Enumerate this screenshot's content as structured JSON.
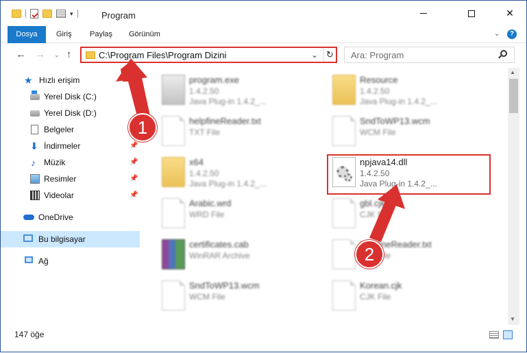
{
  "window": {
    "title": "Program",
    "controls": {
      "minimize": "–",
      "maximize": "☐",
      "close": "✕"
    }
  },
  "ribbon": {
    "tabs": [
      {
        "label": "Dosya",
        "active": true
      },
      {
        "label": "Giriş"
      },
      {
        "label": "Paylaş"
      },
      {
        "label": "Görünüm"
      }
    ],
    "help": "?"
  },
  "navigation": {
    "address": "C:\\Program Files\\Program Dizini",
    "search_placeholder": "Ara: Program"
  },
  "sidebar": {
    "items": [
      {
        "label": "Hızlı erişim",
        "icon": "star-icon"
      },
      {
        "label": "Yerel Disk (C:)",
        "icon": "drive-icon",
        "pinned": true
      },
      {
        "label": "Yerel Disk (D:)",
        "icon": "drive-icon",
        "pinned": true
      },
      {
        "label": "Belgeler",
        "icon": "documents-icon",
        "pinned": true
      },
      {
        "label": "İndirmeler",
        "icon": "downloads-icon",
        "pinned": true
      },
      {
        "label": "Müzik",
        "icon": "music-icon",
        "pinned": true
      },
      {
        "label": "Resimler",
        "icon": "pictures-icon",
        "pinned": true
      },
      {
        "label": "Videolar",
        "icon": "videos-icon",
        "pinned": true
      },
      {
        "label": "OneDrive",
        "icon": "cloud-icon"
      },
      {
        "label": "Bu bilgisayar",
        "icon": "computer-icon",
        "selected": true
      },
      {
        "label": "Ağ",
        "icon": "network-icon"
      }
    ]
  },
  "files": [
    {
      "name": "program.exe",
      "line2": "1.4.2.50",
      "line3": "Java Plug-in 1.4.2_...",
      "icon": "exe-icon"
    },
    {
      "name": "Resource",
      "line2": "1.4.2.50",
      "line3": "Java Plug-in 1.4.2_...",
      "icon": "folder-icon"
    },
    {
      "name": "helpfineReader.txt",
      "line2": "TXT File",
      "line3": "",
      "icon": "document-icon"
    },
    {
      "name": "SndToWP13.wcm",
      "line2": "WCM File",
      "line3": "",
      "icon": "document-icon"
    },
    {
      "name": "x64",
      "line2": "1.4.2.50",
      "line3": "Java Plug-in 1.4.2_...",
      "icon": "folder-icon"
    },
    {
      "name": "npjava14.dll",
      "line2": "1.4.2.50",
      "line3": "Java Plug-in 1.4.2_...",
      "icon": "dll-gear-icon",
      "highlighted": true
    },
    {
      "name": "Arabic.wrd",
      "line2": "WRD File",
      "line3": "",
      "icon": "document-icon"
    },
    {
      "name": "gbl.cjk",
      "line2": "CJK File",
      "line3": "",
      "icon": "document-icon"
    },
    {
      "name": "certificates.cab",
      "line2": "WinRAR Archive",
      "line3": "",
      "icon": "archive-icon"
    },
    {
      "name": "helpfineReader.txt",
      "line2": "TXT File",
      "line3": "",
      "icon": "document-icon"
    },
    {
      "name": "SndToWP13.wcm",
      "line2": "WCM File",
      "line3": "",
      "icon": "document-icon"
    },
    {
      "name": "Korean.cjk",
      "line2": "CJK File",
      "line3": "",
      "icon": "document-icon"
    }
  ],
  "status": {
    "item_count": "147 öğe"
  },
  "annotations": {
    "step1": "1",
    "step2": "2",
    "color": "#d9312f"
  }
}
